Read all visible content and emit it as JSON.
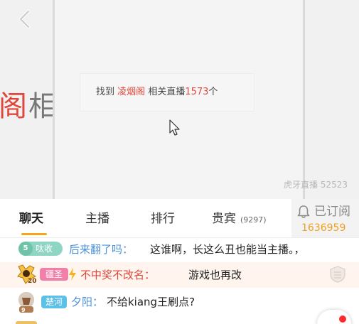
{
  "video": {
    "left_big_text": "阁",
    "left_big_text_tail": "相",
    "search_result": {
      "prefix": "找到",
      "keyword": "凌烟阁",
      "middle": "相关直播",
      "count": "1573",
      "suffix": "个"
    },
    "watermark": "虎牙直播 52523"
  },
  "tabs": {
    "chat": "聊天",
    "host": "主播",
    "rank": "排行",
    "vip": "贵宾",
    "vip_count": "(9297)",
    "active": "聊天"
  },
  "subscribe": {
    "label": "已订阅",
    "count": "1636959"
  },
  "chat": {
    "messages": [
      {
        "level": "5",
        "fan_badge": "呔收",
        "nick": "后来翻了吗：",
        "text": "这谁啊，长这么丑也能当主播。，"
      },
      {
        "noble_level": "20",
        "fan_badge": "疆圣",
        "nick": "不中奖不改名：",
        "text": "游戏也再改"
      },
      {
        "avatar_level": "9",
        "fan_badge": "楚河",
        "nick": "夕阳：",
        "text": "不给kiang王刷点?"
      }
    ]
  },
  "colors": {
    "accent": "#f7a41d",
    "keyword_red": "#e0473b",
    "nick_blue": "#4a8fd9",
    "subscribe_orange": "#f0a020"
  }
}
